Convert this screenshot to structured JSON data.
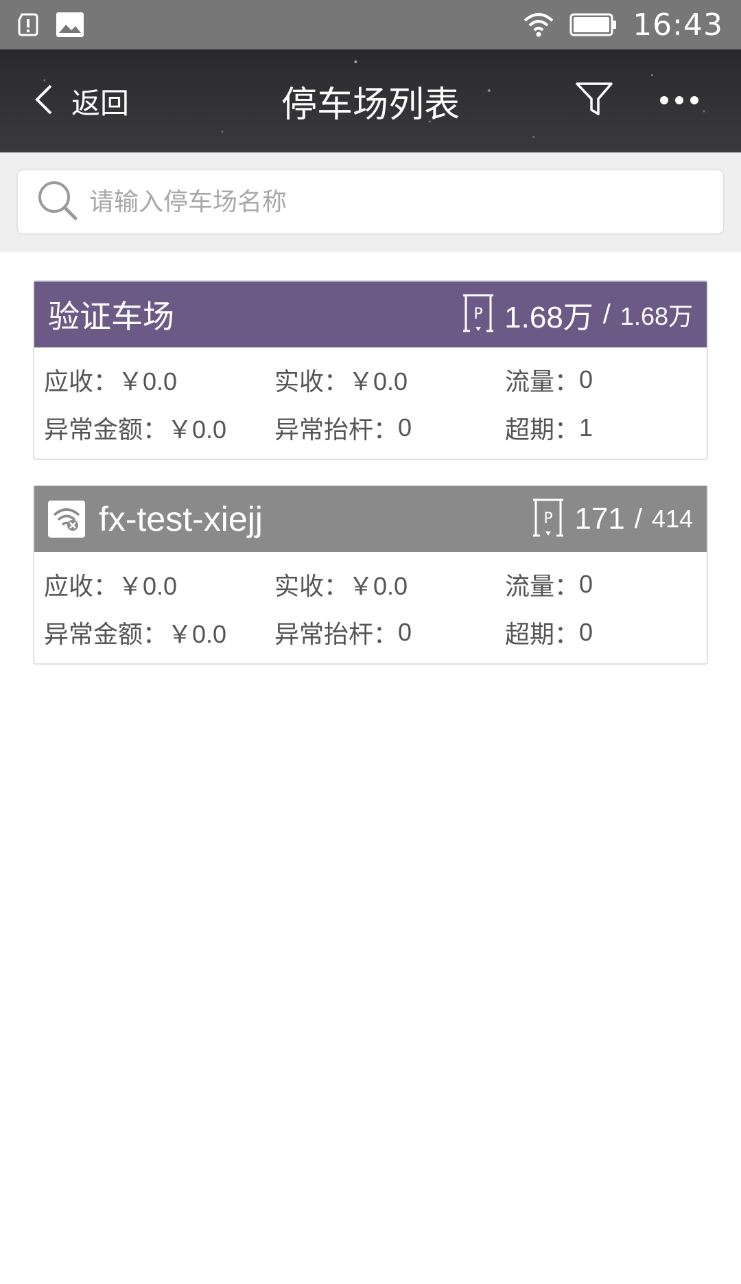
{
  "status_bar": {
    "time": "16:43",
    "icons": [
      "alert-icon",
      "image-icon",
      "wifi-icon",
      "battery-icon"
    ]
  },
  "header": {
    "back_label": "返回",
    "title": "停车场列表",
    "icons": [
      "chevron-left-icon",
      "filter-icon",
      "more-icon"
    ]
  },
  "search": {
    "placeholder": "请输入停车场名称",
    "value": ""
  },
  "colors": {
    "online_header": "#6b5a86",
    "offline_header": "#8a8a8a",
    "status_bar": "#777777",
    "title_bar": "#2f2f31",
    "search_bg": "#efefef"
  },
  "lots": [
    {
      "name": "验证车场",
      "status": "online",
      "capacity_used": "1.68万",
      "capacity_sep": "/",
      "capacity_total": "1.68万",
      "receivable_label": "应收：",
      "receivable": "￥0.0",
      "received_label": "实收：",
      "received": "￥0.0",
      "traffic_label": "流量：",
      "traffic": "0",
      "abnormal_amount_label": "异常金额：",
      "abnormal_amount": "￥0.0",
      "abnormal_lift_label": "异常抬杆：",
      "abnormal_lift": "0",
      "overdue_label": "超期：",
      "overdue": "1"
    },
    {
      "name": "fx-test-xiejj",
      "status": "offline",
      "capacity_used": "171",
      "capacity_sep": "/",
      "capacity_total": "414",
      "receivable_label": "应收：",
      "receivable": "￥0.0",
      "received_label": "实收：",
      "received": "￥0.0",
      "traffic_label": "流量：",
      "traffic": "0",
      "abnormal_amount_label": "异常金额：",
      "abnormal_amount": "￥0.0",
      "abnormal_lift_label": "异常抬杆：",
      "abnormal_lift": "0",
      "overdue_label": "超期：",
      "overdue": "0"
    }
  ]
}
